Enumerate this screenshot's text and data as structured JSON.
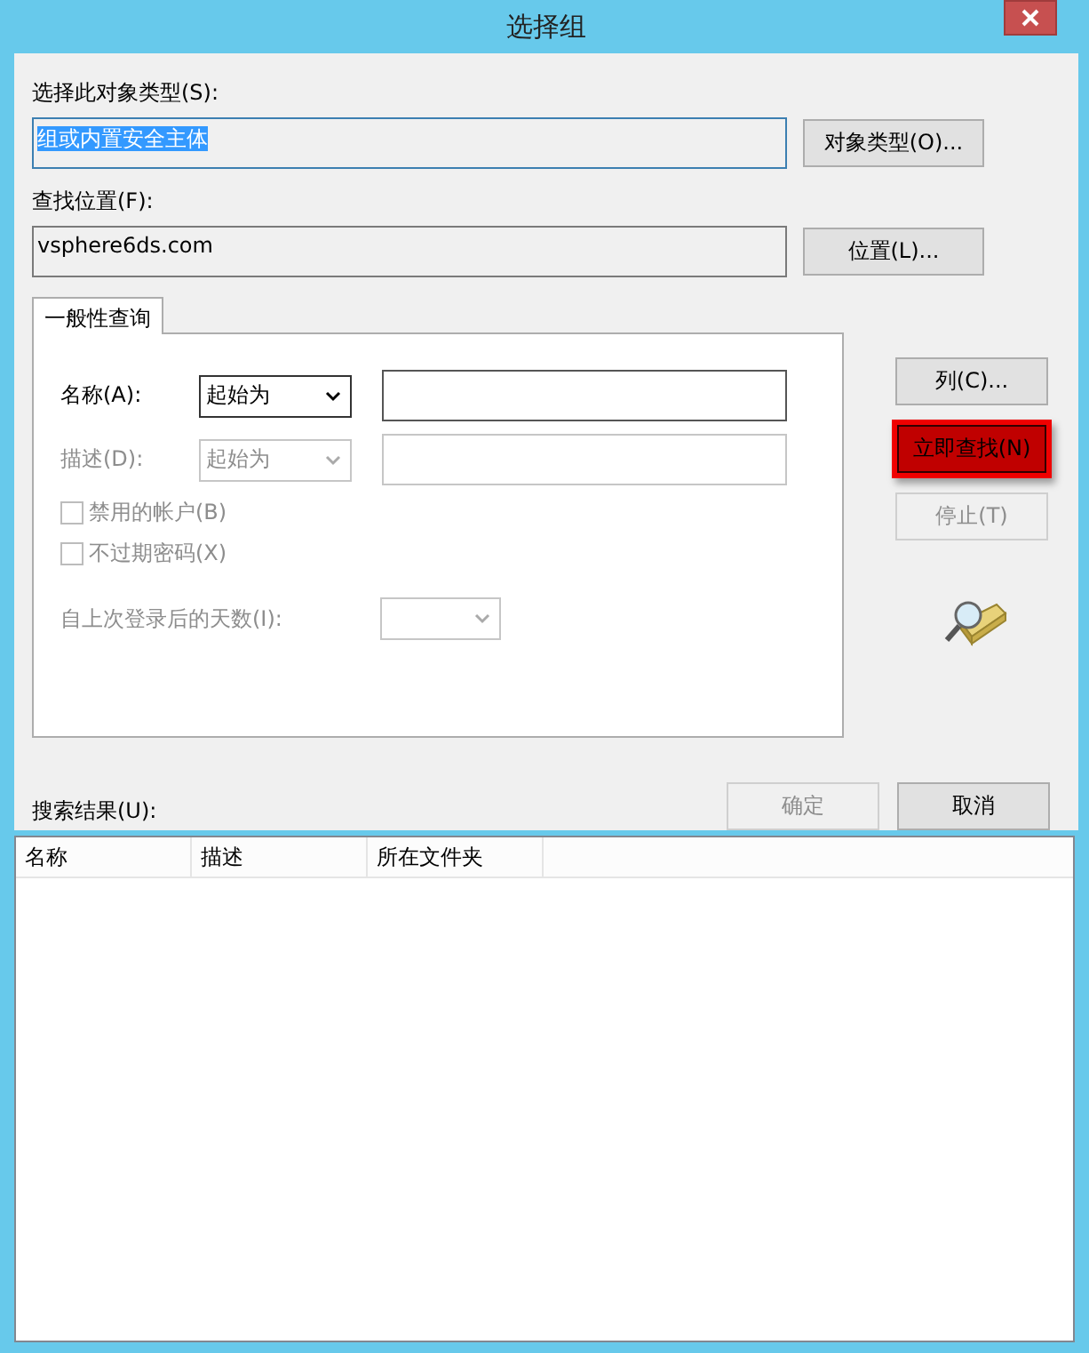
{
  "window": {
    "title": "选择组"
  },
  "object_type": {
    "label": "选择此对象类型(S):",
    "value": "组或内置安全主体",
    "value_selected": true,
    "button": "对象类型(O)..."
  },
  "location": {
    "label": "查找位置(F):",
    "value": "vsphere6ds.com",
    "button": "位置(L)..."
  },
  "tabs": [
    {
      "label": "一般性查询",
      "selected": true
    }
  ],
  "query_rows": [
    {
      "label": "名称(A):",
      "operator": "起始为",
      "disabled": false
    },
    {
      "label": "描述(D):",
      "operator": "起始为",
      "disabled": true
    }
  ],
  "checkboxes": [
    {
      "label": "禁用的帐户(B)",
      "checked": false,
      "disabled": true
    },
    {
      "label": "不过期密码(X)",
      "checked": false,
      "disabled": true
    }
  ],
  "days": {
    "label": "自上次登录后的天数(I):",
    "disabled": true
  },
  "side_buttons": [
    {
      "label": "列(C)...",
      "disabled": false,
      "highlighted": false
    },
    {
      "label": "立即查找(N)",
      "disabled": false,
      "highlighted": true
    },
    {
      "label": "停止(T)",
      "disabled": true,
      "highlighted": false
    }
  ],
  "dialog_buttons": [
    {
      "label": "确定",
      "disabled": true
    },
    {
      "label": "取消",
      "disabled": false
    }
  ],
  "results": {
    "label": "搜索结果(U):",
    "columns": [
      "名称",
      "描述",
      "所在文件夹"
    ]
  }
}
